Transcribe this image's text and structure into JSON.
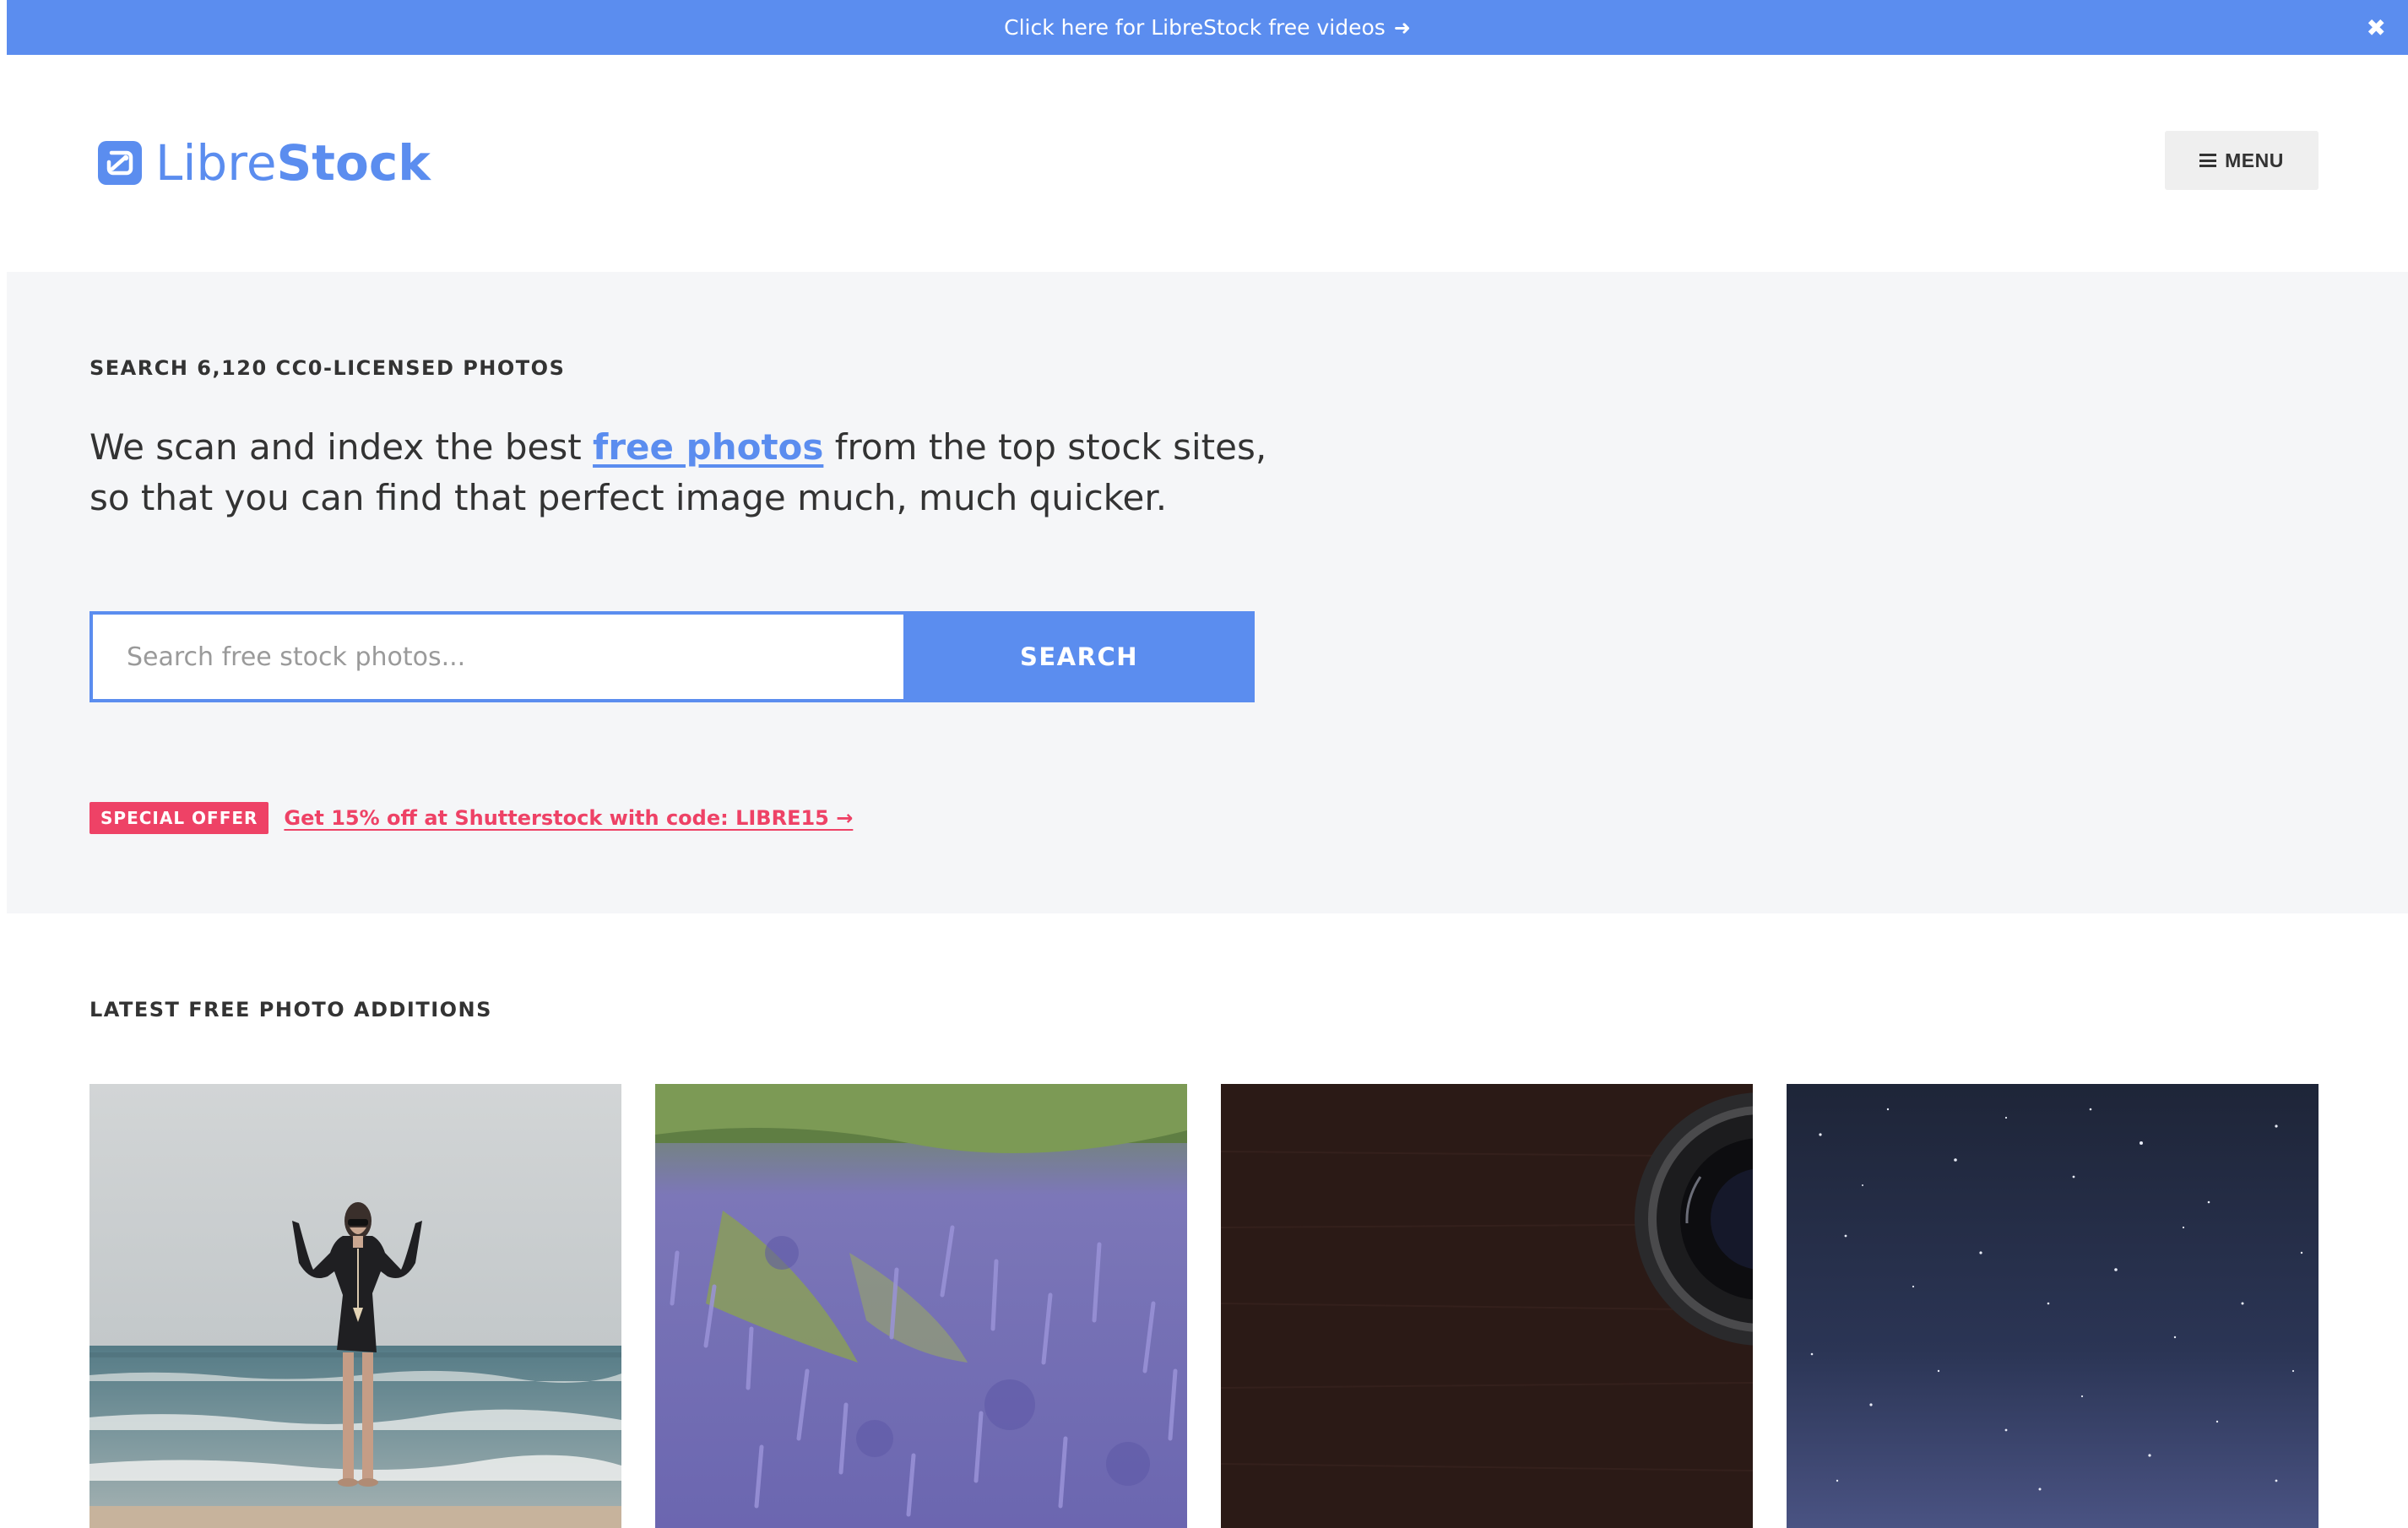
{
  "banner": {
    "text": "Click here for LibreStock free videos",
    "arrow_icon": "arrow-right-icon",
    "close_icon": "close-icon"
  },
  "header": {
    "logo_part1": "Libre",
    "logo_part2": "Stock",
    "menu_label": "MENU",
    "menu_icon": "hamburger-icon"
  },
  "hero": {
    "kicker": "SEARCH 6,120 CC0-LICENSED PHOTOS",
    "lede_before": "We scan and index the best ",
    "lede_link": "free photos",
    "lede_after": " from the top stock sites, so that you can find that perfect image much, much quicker.",
    "search_placeholder": "Search free stock photos...",
    "search_value": "",
    "search_button": "SEARCH",
    "offer_badge": "SPECIAL OFFER",
    "offer_link": "Get 15% off at Shutterstock with code: LIBRE15 →"
  },
  "latest": {
    "title": "LATEST FREE PHOTO ADDITIONS",
    "photos": [
      {
        "subject": "woman-on-beach"
      },
      {
        "subject": "lavender-field"
      },
      {
        "subject": "camera-lens-on-dark-wood"
      },
      {
        "subject": "starry-night-sky"
      }
    ]
  },
  "colors": {
    "brand_blue": "#5b8def",
    "offer_pink": "#ee4266",
    "hero_bg": "#f5f6f8",
    "text_dark": "#333333"
  }
}
